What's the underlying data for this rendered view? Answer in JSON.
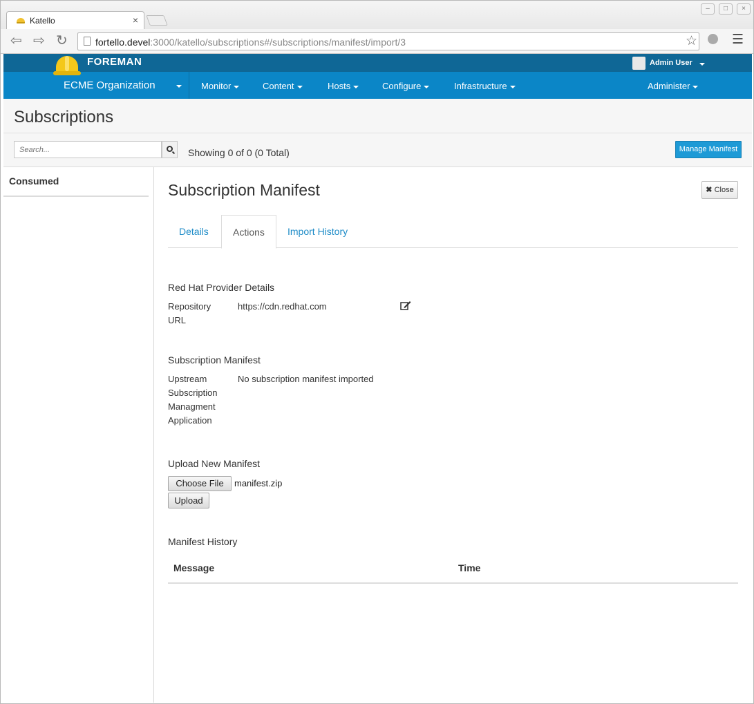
{
  "browser": {
    "tab_title": "Katello",
    "tab_close": "×",
    "url_host": "fortello.devel",
    "url_rest": ":3000/katello/subscriptions#/subscriptions/manifest/import/3",
    "window_buttons": [
      "–",
      "□",
      "×"
    ]
  },
  "header": {
    "brand": "FOREMAN",
    "user": "Admin User",
    "organization": "ECME Organization",
    "nav": [
      "Monitor",
      "Content",
      "Hosts",
      "Configure",
      "Infrastructure"
    ],
    "admin": "Administer"
  },
  "page": {
    "title": "Subscriptions",
    "search_placeholder": "Search...",
    "showing": "Showing 0 of 0 (0 Total)",
    "manage_button": "Manage Manifest"
  },
  "left": {
    "consumed": "Consumed"
  },
  "manifest": {
    "title": "Subscription Manifest",
    "close_label": "Close",
    "tabs": [
      "Details",
      "Actions",
      "Import History"
    ],
    "active_tab": "Actions",
    "provider_heading": "Red Hat Provider Details",
    "repo_label_1": "Repository",
    "repo_label_2": "URL",
    "repo_url": "https://cdn.redhat.com",
    "sm_heading": "Subscription Manifest",
    "upstream_label": [
      "Upstream",
      "Subscription",
      "Managment",
      "Application"
    ],
    "upstream_value": "No subscription manifest imported",
    "upload_heading": "Upload New Manifest",
    "choose_file": "Choose File",
    "file_name": "manifest.zip",
    "upload_button": "Upload",
    "history_heading": "Manifest History",
    "col_message": "Message",
    "col_time": "Time"
  },
  "colors": {
    "brand_bar": "#0f6796",
    "nav_bar": "#0b86c7",
    "link": "#1d8bc7",
    "primary_button": "#1d9ad6"
  }
}
